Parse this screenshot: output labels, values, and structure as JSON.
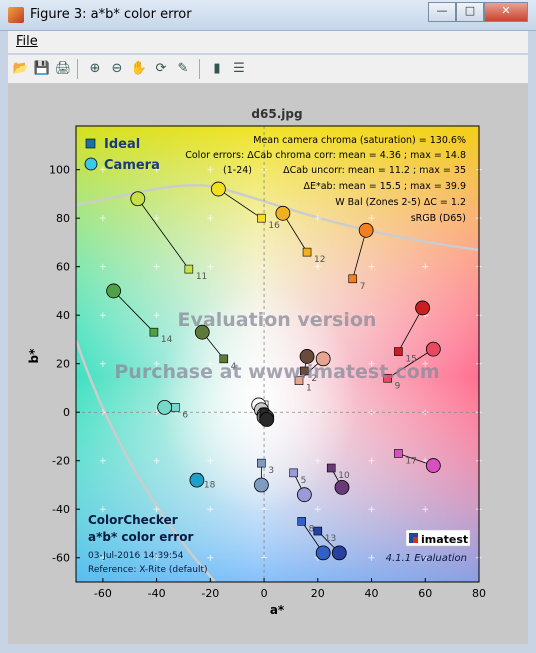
{
  "window": {
    "title": "Figure 3: a*b* color error",
    "btn_min": "—",
    "btn_max": "□",
    "btn_close": "✕"
  },
  "menu": {
    "file": "File"
  },
  "toolbar": [
    "open-icon",
    "save-icon",
    "print-icon",
    "zoom-in-icon",
    "zoom-out-icon",
    "pan-icon",
    "rotate-icon",
    "data-cursor-icon",
    "colorbar-icon",
    "legend-icon"
  ],
  "chart_data": {
    "type": "scatter",
    "title": "d65.jpg",
    "xlabel": "a*",
    "ylabel": "b*",
    "xlim": [
      -70,
      80
    ],
    "ylim": [
      -70,
      118
    ],
    "xticks": [
      -60,
      -40,
      -20,
      0,
      20,
      40,
      60,
      80
    ],
    "yticks": [
      -60,
      -40,
      -20,
      0,
      20,
      40,
      60,
      80,
      100
    ],
    "grid": true,
    "legend": {
      "position": "top-left",
      "entries": [
        "Ideal",
        "Camera"
      ]
    },
    "stats": [
      "Mean camera chroma (saturation) = 130.6%",
      "Color errors: ΔCab chroma corr:  mean = 4.36 ;  max = 14.8",
      "(1-24)",
      "ΔCab uncorr:  mean = 11.2 ;  max = 35",
      "ΔE*ab:  mean = 15.5 ;  max = 39.9",
      "W Bal (Zones 2-5) ΔC = 1.2",
      "sRGB (D65)"
    ],
    "watermark": [
      "Evaluation version",
      "Purchase at www.imatest.com"
    ],
    "info": [
      "ColorChecker",
      "a*b* color error",
      "03-Jul-2016 14:39:54",
      "Reference: X-Rite (default)"
    ],
    "logo": "imatest",
    "version": "4.1.1  Evaluation",
    "patches": [
      {
        "n": "1",
        "ideal": [
          13,
          13
        ],
        "camera": [
          22,
          22
        ],
        "color": "#e8a490"
      },
      {
        "n": "2",
        "ideal": [
          15,
          17
        ],
        "camera": [
          16,
          23
        ],
        "color": "#6a4a3a"
      },
      {
        "n": "3",
        "ideal": [
          -1,
          -21
        ],
        "camera": [
          -1,
          -30
        ],
        "color": "#7f9cc0"
      },
      {
        "n": "4",
        "ideal": [
          -15,
          22
        ],
        "camera": [
          -23,
          33
        ],
        "color": "#5e7a3a"
      },
      {
        "n": "5",
        "ideal": [
          11,
          -25
        ],
        "camera": [
          15,
          -34
        ],
        "color": "#9a9ad8"
      },
      {
        "n": "6",
        "ideal": [
          -33,
          2
        ],
        "camera": [
          -37,
          2
        ],
        "color": "#76d8c8"
      },
      {
        "n": "7",
        "ideal": [
          33,
          55
        ],
        "camera": [
          38,
          75
        ],
        "color": "#f08020"
      },
      {
        "n": "8",
        "ideal": [
          14,
          -45
        ],
        "camera": [
          22,
          -58
        ],
        "color": "#3060c8"
      },
      {
        "n": "9",
        "ideal": [
          46,
          14
        ],
        "camera": [
          63,
          26
        ],
        "color": "#e84860"
      },
      {
        "n": "10",
        "ideal": [
          25,
          -23
        ],
        "camera": [
          29,
          -31
        ],
        "color": "#6a3a78"
      },
      {
        "n": "11",
        "ideal": [
          -28,
          59
        ],
        "camera": [
          -47,
          88
        ],
        "color": "#c8e048"
      },
      {
        "n": "12",
        "ideal": [
          16,
          66
        ],
        "camera": [
          7,
          82
        ],
        "color": "#f0b020"
      },
      {
        "n": "13",
        "ideal": [
          20,
          -49
        ],
        "camera": [
          28,
          -58
        ],
        "color": "#2840a0"
      },
      {
        "n": "14",
        "ideal": [
          -41,
          33
        ],
        "camera": [
          -56,
          50
        ],
        "color": "#50a048"
      },
      {
        "n": "15",
        "ideal": [
          50,
          25
        ],
        "camera": [
          59,
          43
        ],
        "color": "#c82020"
      },
      {
        "n": "16",
        "ideal": [
          -1,
          80
        ],
        "camera": [
          -17,
          92
        ],
        "color": "#f0e020"
      },
      {
        "n": "17",
        "ideal": [
          50,
          -17
        ],
        "camera": [
          63,
          -22
        ],
        "color": "#d850c0"
      },
      {
        "n": "18",
        "ideal": [
          -25,
          -27
        ],
        "camera": [
          -25,
          -28
        ],
        "color": "#20a0c8"
      },
      {
        "n": "19",
        "ideal": [
          0,
          3
        ],
        "camera": [
          -2,
          3
        ],
        "color": "#f8f8f8"
      },
      {
        "n": "20",
        "ideal": [
          0,
          0
        ],
        "camera": [
          -1,
          1
        ],
        "color": "#c8c8c8"
      },
      {
        "n": "21",
        "ideal": [
          0,
          0
        ],
        "camera": [
          0,
          -1
        ],
        "color": "#a0a0a0"
      },
      {
        "n": "22",
        "ideal": [
          0,
          0
        ],
        "camera": [
          0,
          -2
        ],
        "color": "#7a7a7a"
      },
      {
        "n": "23",
        "ideal": [
          0,
          0
        ],
        "camera": [
          1,
          -2
        ],
        "color": "#505050"
      },
      {
        "n": "24",
        "ideal": [
          0,
          0
        ],
        "camera": [
          1,
          -3
        ],
        "color": "#282828"
      }
    ]
  }
}
